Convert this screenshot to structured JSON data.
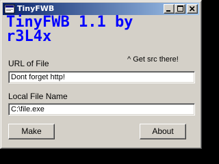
{
  "window": {
    "title": "TinyFWB",
    "minimize_icon": "minimize-icon",
    "maximize_icon": "maximize-icon",
    "close_icon": "close-icon",
    "title_bar_color_start": "#0a246a",
    "title_bar_color_end": "#a6caf0",
    "face_color": "#d4d0c8"
  },
  "header": {
    "heading_line1": "TinyFWB 1.1 by",
    "heading_line2": "r3L4x",
    "heading_color": "#0000ff",
    "note": "^ Get src there!"
  },
  "form": {
    "url_label": "URL of File",
    "url_value": "Dont forget http!",
    "local_label": "Local File Name",
    "local_value": "C:\\file.exe"
  },
  "buttons": {
    "make_label": "Make",
    "about_label": "About"
  }
}
